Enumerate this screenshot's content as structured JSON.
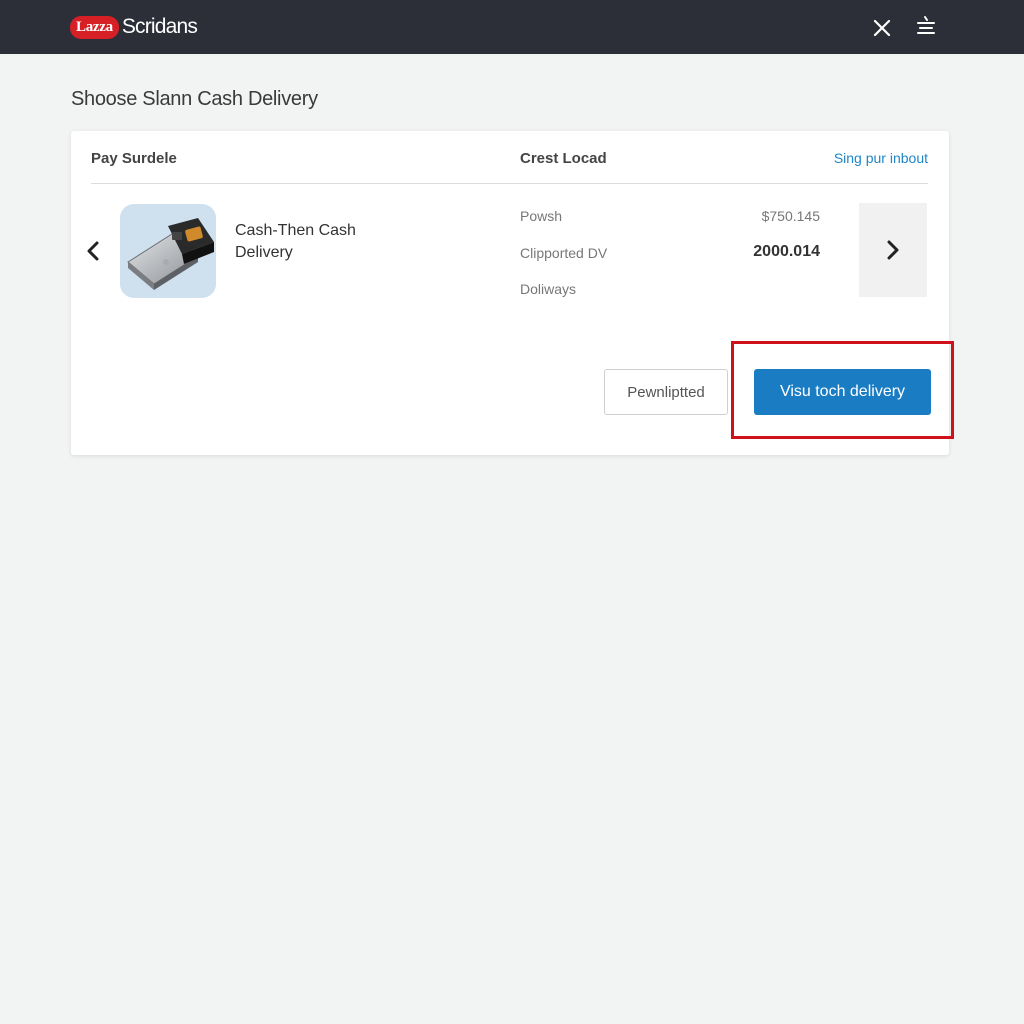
{
  "header": {
    "logo_badge": "Lazza",
    "logo_text": "Scridans",
    "close_icon": "close-icon",
    "menu_icon": "menu-icon"
  },
  "page": {
    "title": "Shoose Slann Cash Delivery"
  },
  "card": {
    "header_left": "Pay Surdele",
    "header_mid": "Crest Locad",
    "header_link": "Sing pur inbout",
    "product": {
      "name": "Cash-Then Cash Delivery",
      "image_icon": "device-image"
    },
    "details": [
      {
        "label": "Powsh",
        "value": "$750.145"
      },
      {
        "label": "Clipported DV",
        "value": "2000.014"
      },
      {
        "label": "Doliways",
        "value": ""
      }
    ],
    "nav": {
      "prev_icon": "chevron-left-icon",
      "next_icon": "chevron-right-icon"
    },
    "buttons": {
      "secondary": "Pewnliptted",
      "primary": "Visu toch delivery"
    }
  },
  "colors": {
    "topbar": "#2c2f37",
    "brand_red": "#d71f26",
    "primary_blue": "#1a7dc4",
    "link_blue": "#1f86c7",
    "highlight_red": "#d0101a"
  }
}
